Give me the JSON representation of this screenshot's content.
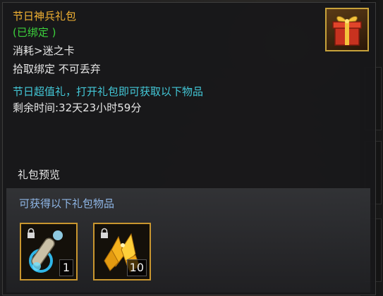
{
  "item": {
    "title": "节日神兵礼包",
    "bound_status": "(已绑定 )",
    "consume": "消耗>迷之卡",
    "pickup_rule": "拾取绑定 不可丢弃",
    "description": "节日超值礼，打开礼包即可获取以下物品",
    "remaining_time": "剩余时间:32天23小时59分",
    "icon": "gift-box-icon"
  },
  "preview": {
    "label": "礼包预览",
    "panel_title": "可获得以下礼包物品",
    "rewards": [
      {
        "icon": "blue-scroll-icon",
        "count": "1",
        "locked": true
      },
      {
        "icon": "gold-crystal-icon",
        "count": "10",
        "locked": true
      }
    ]
  },
  "colors": {
    "title": "#f2b233",
    "bound": "#3cd13c",
    "description": "#43c8d8",
    "panel_title": "#8fb6e6",
    "slot_border": "#c9962f"
  }
}
